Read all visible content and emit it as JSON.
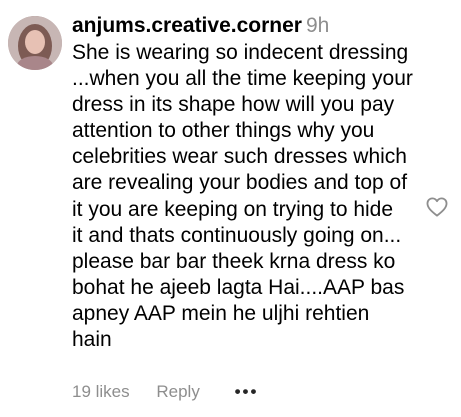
{
  "comment": {
    "username": "anjums.creative.corner",
    "time": "9h",
    "lines": [
      "She is wearing so indecent dressing",
      "...when you all the time keeping your",
      "dress in its shape how will you pay",
      "attention to other things why you",
      "celebrities wear such dresses which",
      "are revealing your bodies and top of",
      "it you are keeping on trying to hide",
      "it and thats continuously going on...",
      "please bar bar theek krna dress ko",
      "bohat he ajeeb lagta Hai....AAP bas",
      "apney AAP mein he uljhi rehtien",
      "hain"
    ],
    "likes": "19 likes",
    "reply_label": "Reply",
    "more_label": "•••",
    "icons": {
      "avatar": "profile-avatar",
      "like": "heart-outline-icon",
      "more": "more-options-icon"
    }
  }
}
